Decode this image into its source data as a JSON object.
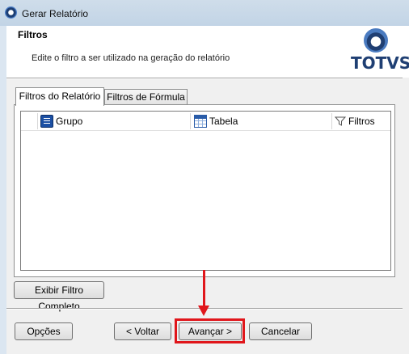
{
  "window": {
    "title": "Gerar Relatório"
  },
  "header": {
    "title": "Filtros",
    "description": "Edite o filtro a ser utilizado na geração do relatório",
    "logo_text": "TOTVS"
  },
  "tabs": [
    {
      "label": "Filtros do Relatório",
      "active": true
    },
    {
      "label": "Filtros de Fórmula",
      "active": false
    }
  ],
  "grid": {
    "columns": [
      {
        "label": "Grupo",
        "icon": "group-icon"
      },
      {
        "label": "Tabela",
        "icon": "table-icon"
      },
      {
        "label": "Filtros",
        "icon": "filter-icon"
      }
    ]
  },
  "buttons": {
    "show_full_filter": "Exibir Filtro Completo",
    "options": "Opções",
    "back": "< Voltar",
    "next": "Avançar >",
    "cancel": "Cancelar"
  },
  "colors": {
    "highlight": "#e0161b",
    "brand": "#1f3f73"
  }
}
